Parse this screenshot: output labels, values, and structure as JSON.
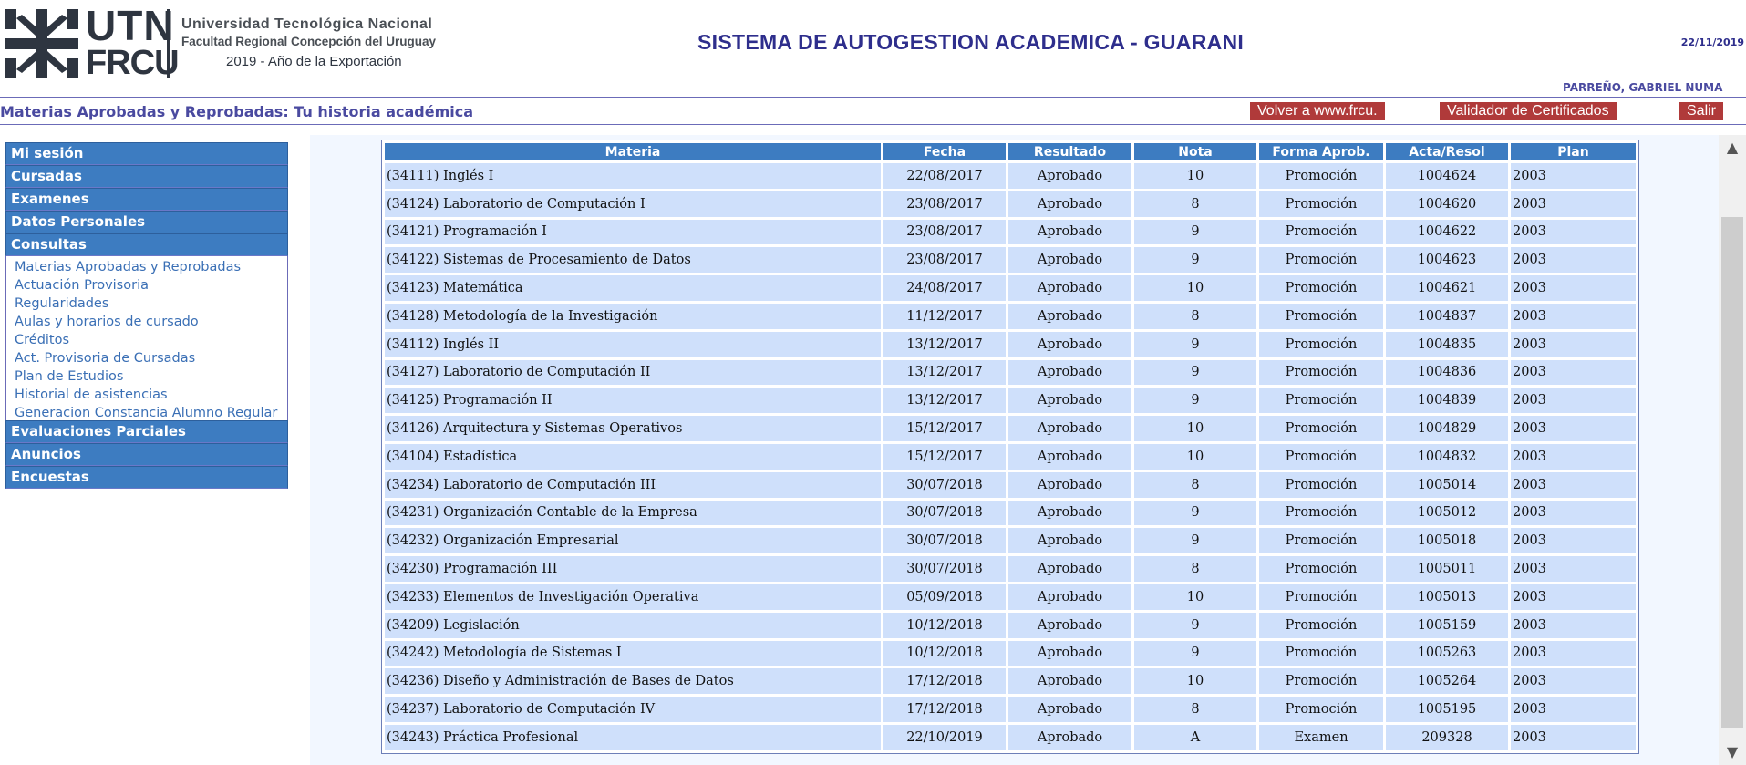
{
  "header": {
    "logo_utn": "UTN",
    "logo_frcu": "FRCU",
    "university": "Universidad Tecnológica Nacional",
    "faculty": "Facultad Regional Concepción del Uruguay",
    "motto": "2019 - Año de la Exportación",
    "app_title": "SISTEMA DE AUTOGESTION ACADEMICA - GUARANI",
    "date": "22/11/2019",
    "user": "PARREÑO, GABRIEL NUMA"
  },
  "toolbar": {
    "page_heading": "Materias Aprobadas y Reprobadas: Tu historia académica",
    "volver_label": "Volver a www.frcu.",
    "validador_label": "Validador de Certificados",
    "salir_label": "Salir"
  },
  "sidebar": {
    "top_sections": [
      "Mi sesión",
      "Cursadas",
      "Examenes",
      "Datos Personales",
      "Consultas"
    ],
    "consultas_items": [
      "Materias Aprobadas y Reprobadas",
      "Actuación Provisoria",
      "Regularidades",
      "Aulas y horarios de cursado",
      "Créditos",
      "Act. Provisoria de Cursadas",
      "Plan de Estudios",
      "Historial de asistencias",
      "Generacion Constancia Alumno Regular"
    ],
    "bottom_sections": [
      "Evaluaciones Parciales",
      "Anuncios",
      "Encuestas"
    ]
  },
  "table": {
    "columns": [
      "Materia",
      "Fecha",
      "Resultado",
      "Nota",
      "Forma Aprob.",
      "Acta/Resol",
      "Plan"
    ],
    "rows": [
      [
        "(34111) Inglés I",
        "22/08/2017",
        "Aprobado",
        "10",
        "Promoción",
        "1004624",
        "2003"
      ],
      [
        "(34124) Laboratorio de Computación I",
        "23/08/2017",
        "Aprobado",
        "8",
        "Promoción",
        "1004620",
        "2003"
      ],
      [
        "(34121) Programación I",
        "23/08/2017",
        "Aprobado",
        "9",
        "Promoción",
        "1004622",
        "2003"
      ],
      [
        "(34122) Sistemas de Procesamiento de Datos",
        "23/08/2017",
        "Aprobado",
        "9",
        "Promoción",
        "1004623",
        "2003"
      ],
      [
        "(34123) Matemática",
        "24/08/2017",
        "Aprobado",
        "10",
        "Promoción",
        "1004621",
        "2003"
      ],
      [
        "(34128) Metodología de la Investigación",
        "11/12/2017",
        "Aprobado",
        "8",
        "Promoción",
        "1004837",
        "2003"
      ],
      [
        "(34112) Inglés II",
        "13/12/2017",
        "Aprobado",
        "9",
        "Promoción",
        "1004835",
        "2003"
      ],
      [
        "(34127) Laboratorio de Computación II",
        "13/12/2017",
        "Aprobado",
        "9",
        "Promoción",
        "1004836",
        "2003"
      ],
      [
        "(34125) Programación II",
        "13/12/2017",
        "Aprobado",
        "9",
        "Promoción",
        "1004839",
        "2003"
      ],
      [
        "(34126) Arquitectura y Sistemas Operativos",
        "15/12/2017",
        "Aprobado",
        "10",
        "Promoción",
        "1004829",
        "2003"
      ],
      [
        "(34104) Estadística",
        "15/12/2017",
        "Aprobado",
        "10",
        "Promoción",
        "1004832",
        "2003"
      ],
      [
        "(34234) Laboratorio de Computación III",
        "30/07/2018",
        "Aprobado",
        "8",
        "Promoción",
        "1005014",
        "2003"
      ],
      [
        "(34231) Organización Contable de la Empresa",
        "30/07/2018",
        "Aprobado",
        "9",
        "Promoción",
        "1005012",
        "2003"
      ],
      [
        "(34232) Organización Empresarial",
        "30/07/2018",
        "Aprobado",
        "9",
        "Promoción",
        "1005018",
        "2003"
      ],
      [
        "(34230) Programación III",
        "30/07/2018",
        "Aprobado",
        "8",
        "Promoción",
        "1005011",
        "2003"
      ],
      [
        "(34233) Elementos de Investigación Operativa",
        "05/09/2018",
        "Aprobado",
        "10",
        "Promoción",
        "1005013",
        "2003"
      ],
      [
        "(34209) Legislación",
        "10/12/2018",
        "Aprobado",
        "9",
        "Promoción",
        "1005159",
        "2003"
      ],
      [
        "(34242) Metodología de Sistemas I",
        "10/12/2018",
        "Aprobado",
        "9",
        "Promoción",
        "1005263",
        "2003"
      ],
      [
        "(34236) Diseño y Administración de Bases de Datos",
        "17/12/2018",
        "Aprobado",
        "10",
        "Promoción",
        "1005264",
        "2003"
      ],
      [
        "(34237) Laboratorio de Computación IV",
        "17/12/2018",
        "Aprobado",
        "8",
        "Promoción",
        "1005195",
        "2003"
      ],
      [
        "(34243) Práctica Profesional",
        "22/10/2019",
        "Aprobado",
        "A",
        "Examen",
        "209328",
        "2003"
      ]
    ]
  },
  "colors": {
    "menu_blue": "#3d7cc1",
    "row_blue": "#cfe0fb",
    "button_red": "#b03a3a",
    "title_navy": "#2e2e8c"
  },
  "icons": [
    "utn-logo-icon",
    "scroll-up-icon",
    "scroll-down-icon"
  ]
}
